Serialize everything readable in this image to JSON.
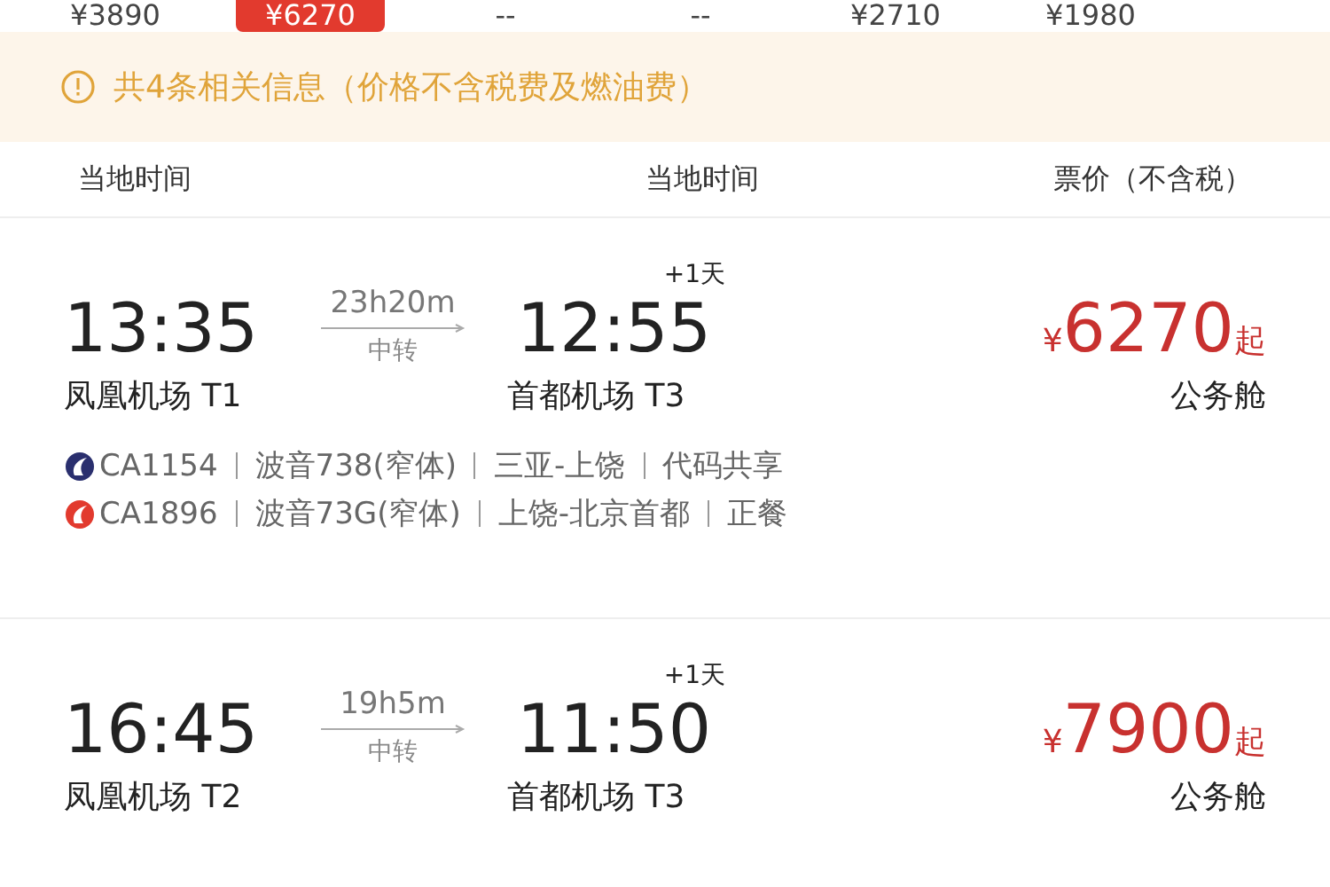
{
  "price_strip": [
    {
      "price": "¥3890",
      "selected": false
    },
    {
      "price": "¥6270",
      "selected": true
    },
    {
      "price": "--",
      "selected": false
    },
    {
      "price": "--",
      "selected": false
    },
    {
      "price": "¥2710",
      "selected": false
    },
    {
      "price": "¥1980",
      "selected": false
    }
  ],
  "notice": {
    "text": "共4条相关信息（价格不含税费及燃油费）"
  },
  "header": {
    "depart": "当地时间",
    "arrive": "当地时间",
    "price": "票价（不含税）"
  },
  "flights": [
    {
      "depart_time": "13:35",
      "duration": "23h20m",
      "transfer": "中转",
      "arrive_time": "12:55",
      "day_offset": "+1天",
      "depart_airport": "凤凰机场 T1",
      "arrive_airport": "首都机场 T3",
      "price": "6270",
      "currency": "¥",
      "price_suffix": "起",
      "cabin": "公务舱",
      "segments": [
        {
          "flight": "CA1154",
          "aircraft": "波音738(窄体)",
          "route": "三亚-上饶",
          "note": "代码共享",
          "color": "#2a2f6e"
        },
        {
          "flight": "CA1896",
          "aircraft": "波音73G(窄体)",
          "route": "上饶-北京首都",
          "note": "正餐",
          "color": "#e23a2e"
        }
      ]
    },
    {
      "depart_time": "16:45",
      "duration": "19h5m",
      "transfer": "中转",
      "arrive_time": "11:50",
      "day_offset": "+1天",
      "depart_airport": "凤凰机场 T2",
      "arrive_airport": "首都机场 T3",
      "price": "7900",
      "currency": "¥",
      "price_suffix": "起",
      "cabin": "公务舱"
    }
  ]
}
